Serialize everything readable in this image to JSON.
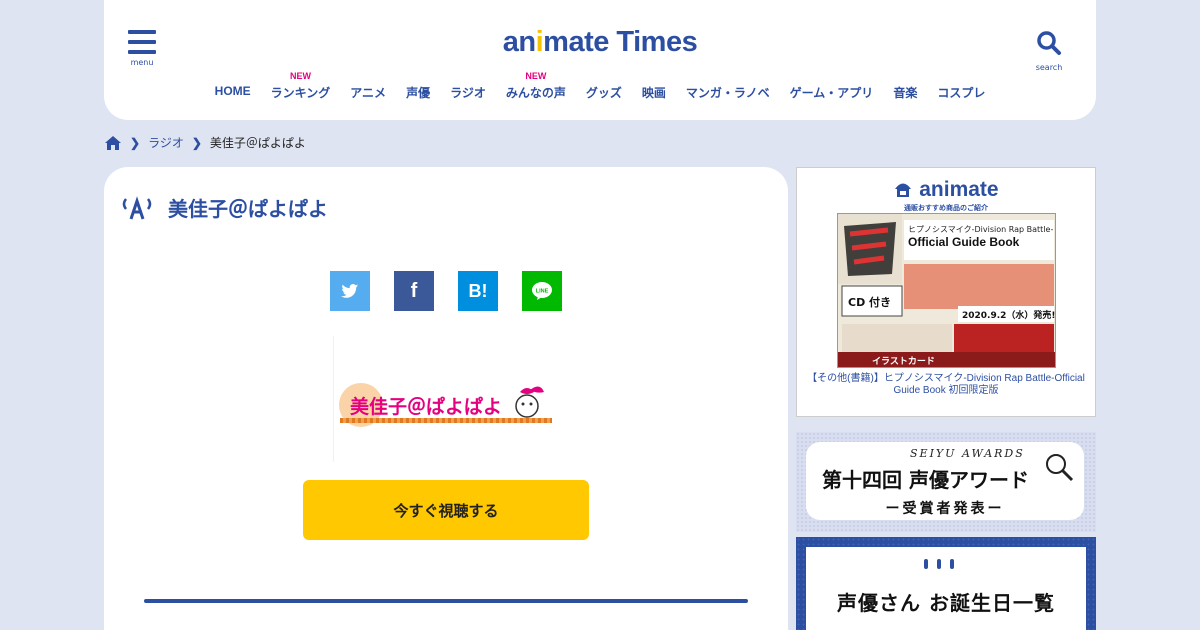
{
  "header": {
    "menu_label": "menu",
    "search_label": "search",
    "logo_text_a": "an",
    "logo_text_i": "i",
    "logo_text_b": "mate Times",
    "nav": [
      {
        "label": "HOME",
        "badge": ""
      },
      {
        "label": "ランキング",
        "badge": "NEW"
      },
      {
        "label": "アニメ",
        "badge": ""
      },
      {
        "label": "声優",
        "badge": ""
      },
      {
        "label": "ラジオ",
        "badge": ""
      },
      {
        "label": "みんなの声",
        "badge": "NEW"
      },
      {
        "label": "グッズ",
        "badge": ""
      },
      {
        "label": "映画",
        "badge": ""
      },
      {
        "label": "マンガ・ラノベ",
        "badge": ""
      },
      {
        "label": "ゲーム・アプリ",
        "badge": ""
      },
      {
        "label": "音楽",
        "badge": ""
      },
      {
        "label": "コスプレ",
        "badge": ""
      }
    ]
  },
  "breadcrumb": {
    "items": [
      "ラジオ"
    ],
    "current": "美佳子＠ぱよぱよ"
  },
  "main": {
    "title": "美佳子＠ぱよぱよ",
    "program_logo_text": "美佳子＠ぱよぱよ",
    "watch_label": "今すぐ視聴する"
  },
  "share": {
    "hatena_label": "B!"
  },
  "sidebar": {
    "ad": {
      "logo": "animate",
      "sub": "通販おすすめ商品のご紹介",
      "book_title_jp": "ヒプノシスマイク-Division Rap Battle-",
      "book_title_en": "Official Guide Book",
      "book_release": "2020.9.2（水）発売!",
      "book_cd": "CD 付き",
      "book_card": "イラストカード",
      "caption": "【その他(書籍)】ヒプノシスマイク-Division Rap Battle-Official Guide Book 初回限定版"
    },
    "award": {
      "sub": "SEIYU AWARDS",
      "title": "第十四回 声優アワード",
      "foot": "ー受賞者発表ー"
    },
    "birthday": {
      "title": "声優さん お誕生日一覧"
    }
  },
  "colors": {
    "brand": "#2d4fa2",
    "accent": "#f6c300",
    "new_badge": "#e4007f",
    "watch_button": "#ffc800"
  }
}
